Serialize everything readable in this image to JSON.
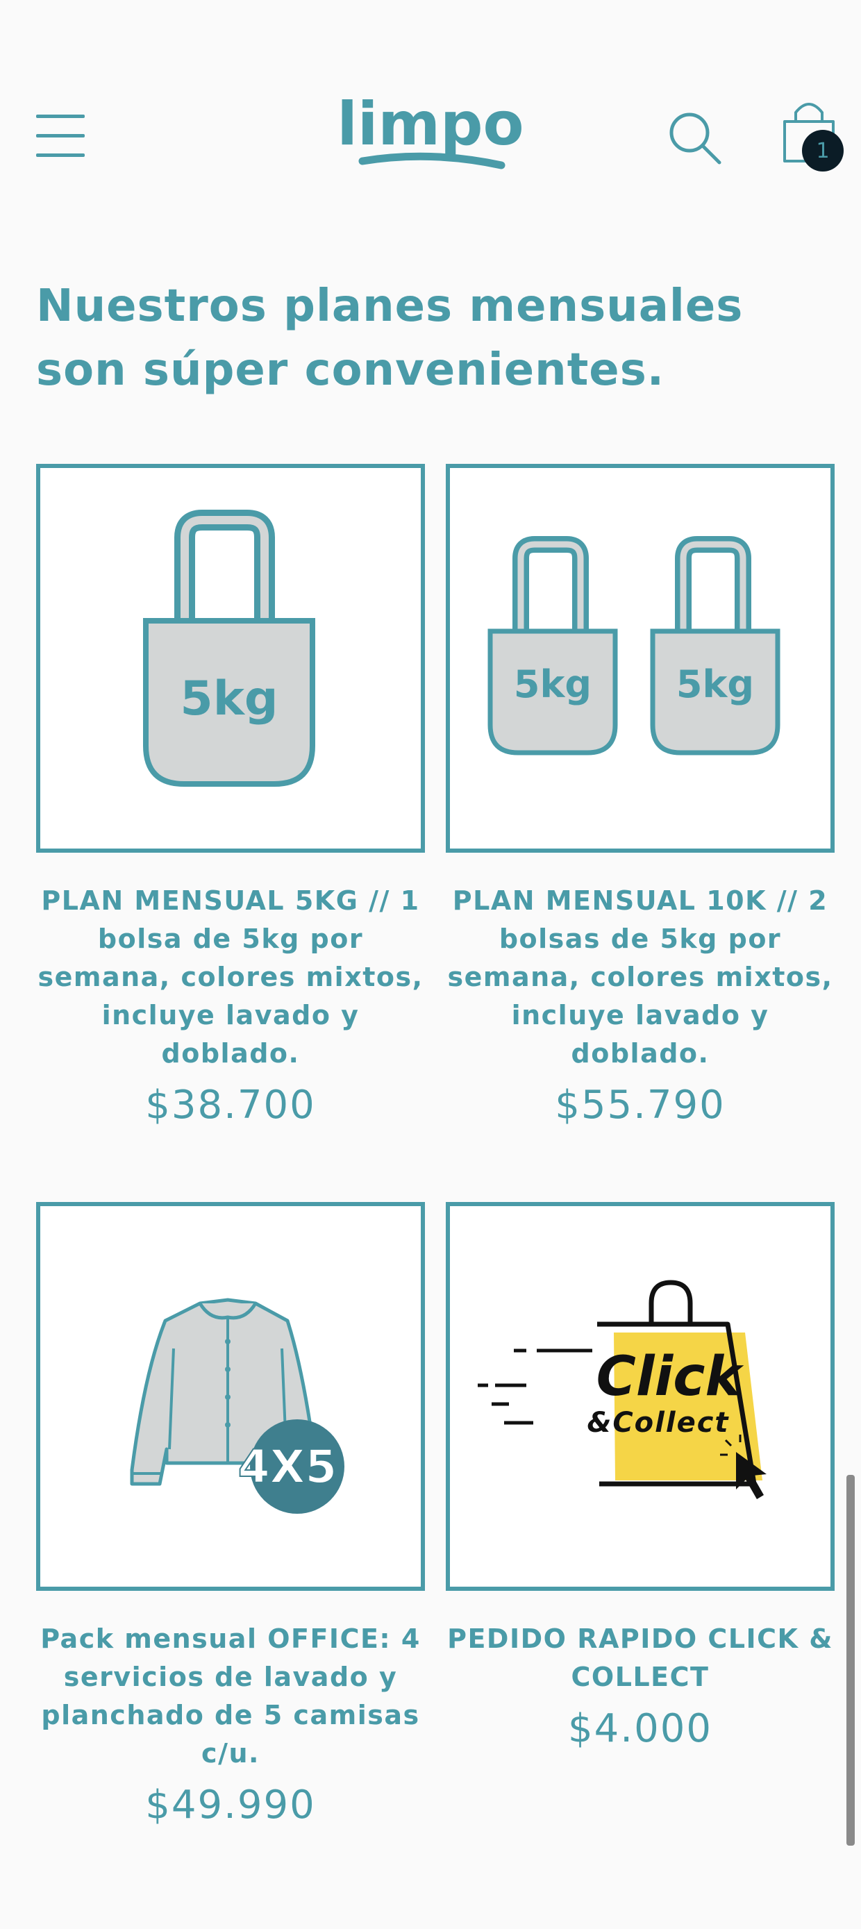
{
  "header": {
    "logo_text": "limpo",
    "cart_count": "1"
  },
  "section": {
    "title": "Nuestros planes mensuales son súper convenientes."
  },
  "products": [
    {
      "name": "PLAN MENSUAL 5KG // 1 bolsa de 5kg por semana, colores mixtos, incluye lavado y doblado.",
      "price": "$38.700",
      "image_label": "5kg"
    },
    {
      "name": "PLAN MENSUAL 10K // 2 bolsas de 5kg por semana, colores mixtos, incluye lavado y doblado.",
      "price": "$55.790",
      "image_label": "5kg"
    },
    {
      "name": "Pack mensual OFFICE: 4 servicios de lavado y planchado de 5 camisas c/u.",
      "price": "$49.990",
      "image_label": "4X5"
    },
    {
      "name": "PEDIDO RAPIDO CLICK & COLLECT",
      "price": "$4.000",
      "image_label_1": "Click",
      "image_label_2": "&Collect"
    }
  ],
  "colors": {
    "brand": "#4a9ba8",
    "background": "#fafafa",
    "bag_fill": "#d3d6d6",
    "badge_dark": "#0b1c26",
    "click_yellow": "#f5d547"
  }
}
